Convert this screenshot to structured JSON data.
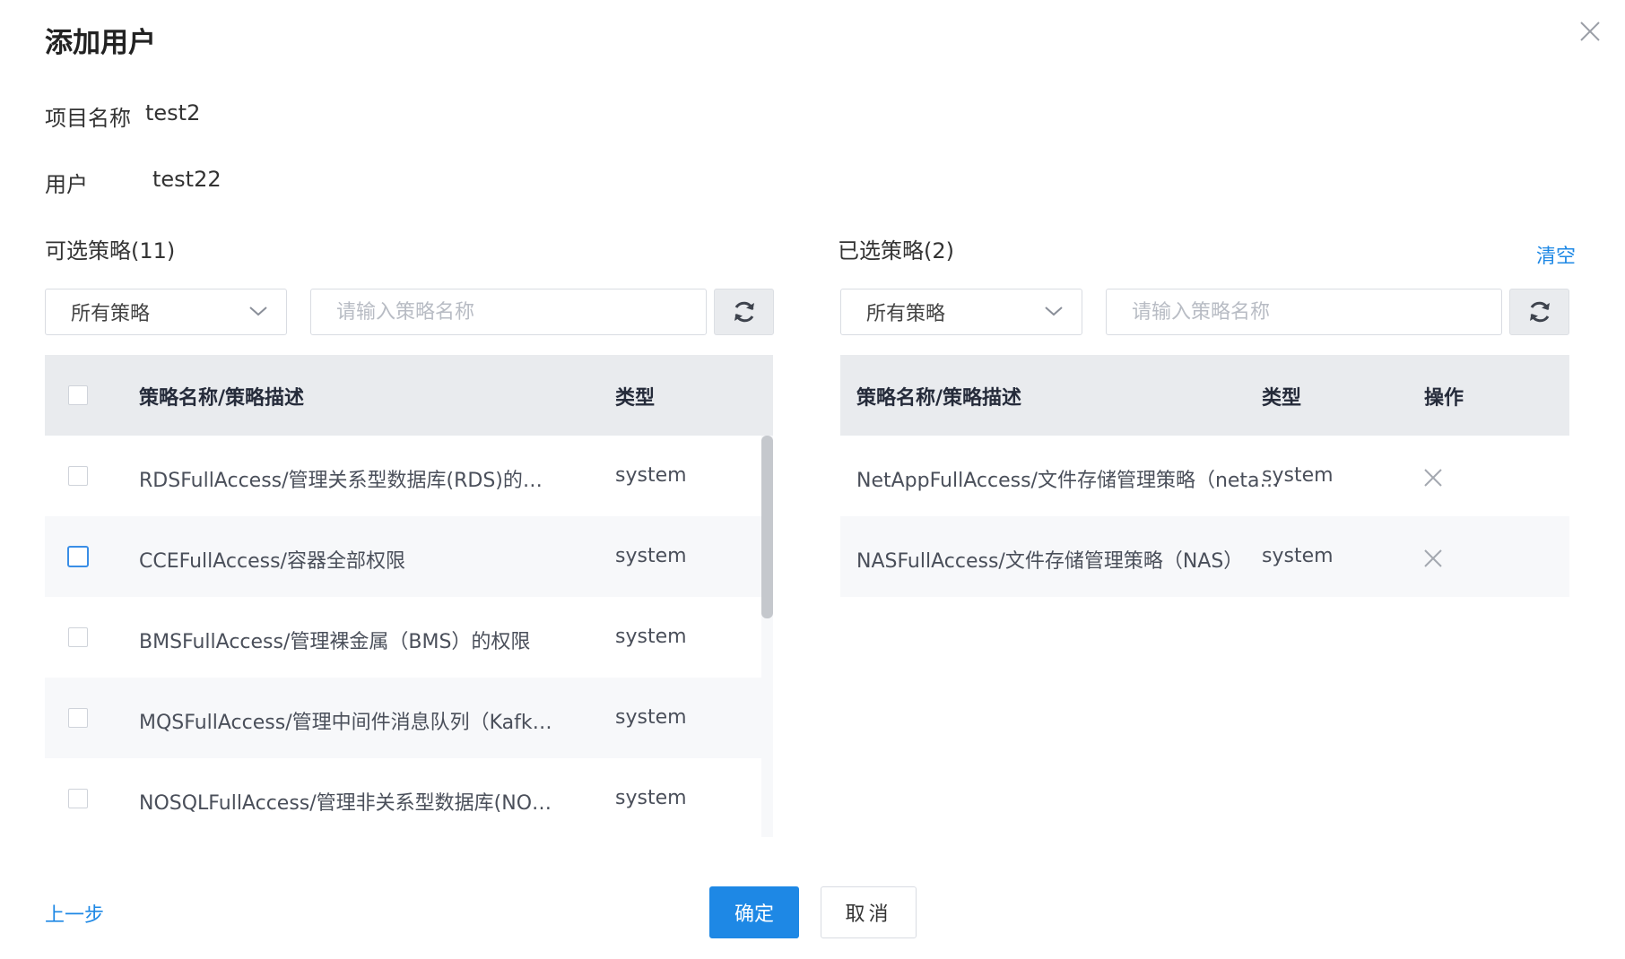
{
  "dialog": {
    "title": "添加用户"
  },
  "project": {
    "label": "项目名称",
    "value": "test2"
  },
  "user": {
    "label": "用户",
    "value": "test22"
  },
  "available": {
    "title": "可选策略(11)",
    "filter_selected": "所有策略",
    "search_placeholder": "请输入策略名称",
    "headers": {
      "name": "策略名称/策略描述",
      "type": "类型"
    },
    "rows": [
      {
        "name": "RDSFullAccess/管理关系型数据库(RDS)的…",
        "type": "system"
      },
      {
        "name": "CCEFullAccess/容器全部权限",
        "type": "system"
      },
      {
        "name": "BMSFullAccess/管理裸金属（BMS）的权限",
        "type": "system"
      },
      {
        "name": "MQSFullAccess/管理中间件消息队列（Kafk…",
        "type": "system"
      },
      {
        "name": "NOSQLFullAccess/管理非关系型数据库(NO…",
        "type": "system"
      }
    ]
  },
  "selected": {
    "title": "已选策略(2)",
    "clear_label": "清空",
    "filter_selected": "所有策略",
    "search_placeholder": "请输入策略名称",
    "headers": {
      "name": "策略名称/策略描述",
      "type": "类型",
      "action": "操作"
    },
    "rows": [
      {
        "name": "NetAppFullAccess/文件存储管理策略（neta…",
        "type": "system"
      },
      {
        "name": "NASFullAccess/文件存储管理策略（NAS）",
        "type": "system"
      }
    ]
  },
  "footer": {
    "prev_label": "上一步",
    "ok_label": "确定",
    "cancel_label": "取消"
  },
  "colors": {
    "primary": "#1e88e5",
    "header_bg": "#e9ebee",
    "row_alt_bg": "#f7f8fa"
  },
  "icons": [
    "close-icon",
    "chevron-down-icon",
    "refresh-icon",
    "delete-x-icon"
  ]
}
